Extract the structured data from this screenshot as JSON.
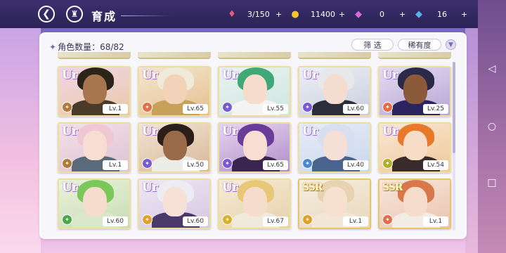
{
  "header": {
    "back_icon": "arrow-left-icon",
    "home_icon": "castle-icon",
    "title": "育成"
  },
  "resources": [
    {
      "name": "candy",
      "icon": "candy-icon",
      "value": "3/150",
      "color": "#e85a7a"
    },
    {
      "name": "coin",
      "icon": "coin-icon",
      "value": "11400",
      "color": "#f2c230"
    },
    {
      "name": "gem-pink",
      "icon": "gem-icon",
      "value": "0",
      "color": "#d86ad8"
    },
    {
      "name": "gem-blue",
      "icon": "diamond-icon",
      "value": "16",
      "color": "#5ab0f0"
    }
  ],
  "panel": {
    "count_label": "角色数量：68/82",
    "filter_label": "筛 选",
    "sort_label": "稀有度"
  },
  "cards": [
    {
      "rarity": "UR",
      "level": "Lv.1",
      "attr_color": "#b07a3a",
      "bg": [
        "#f3d6e6",
        "#e8c9a8"
      ],
      "hair": "#2b2418",
      "skin": "#a8764e",
      "body": "#4a3a2a"
    },
    {
      "rarity": "UR",
      "level": "Lv.65",
      "attr_color": "#e0704a",
      "bg": [
        "#f5e6d2",
        "#e3c08c"
      ],
      "hair": "#f0ead8",
      "skin": "#f2d2b8",
      "body": "#c7a05a"
    },
    {
      "rarity": "UR",
      "level": "Lv.55",
      "attr_color": "#7a5ad0",
      "bg": [
        "#e9f2f0",
        "#cfe7e0"
      ],
      "hair": "#3fa876",
      "skin": "#f6dccb",
      "body": "#f4f4f4"
    },
    {
      "rarity": "UR",
      "level": "Lv.60",
      "attr_color": "#7a5ad0",
      "bg": [
        "#eef0f6",
        "#c9cede"
      ],
      "hair": "#e8e8ea",
      "skin": "#f5dcd0",
      "body": "#2c2c3a"
    },
    {
      "rarity": "UR",
      "level": "Lv.25",
      "attr_color": "#e0704a",
      "bg": [
        "#e4dcf0",
        "#b7a5d6"
      ],
      "hair": "#2a2a48",
      "skin": "#8a5a3a",
      "body": "#2b2460"
    },
    {
      "rarity": "UR",
      "level": "Lv.1",
      "attr_color": "#b07a3a",
      "bg": [
        "#f4e2e8",
        "#dcc2d2"
      ],
      "hair": "#f0c8d4",
      "skin": "#f7ddd2",
      "body": "#5a6a7a"
    },
    {
      "rarity": "UR",
      "level": "Lv.50",
      "attr_color": "#7a5ad0",
      "bg": [
        "#f2e4d4",
        "#d8b898"
      ],
      "hair": "#2a1e18",
      "skin": "#9a6a48",
      "body": "#ecece8"
    },
    {
      "rarity": "UR",
      "level": "Lv.65",
      "attr_color": "#7a5ad0",
      "bg": [
        "#e6d6ee",
        "#b08cc8"
      ],
      "hair": "#6a3c9a",
      "skin": "#f7ddd2",
      "body": "#3a2450"
    },
    {
      "rarity": "UR",
      "level": "Lv.40",
      "attr_color": "#4a8ad0",
      "bg": [
        "#e8eef8",
        "#c8d6ec"
      ],
      "hair": "#d8e0f0",
      "skin": "#f5e0d8",
      "body": "#4a6490"
    },
    {
      "rarity": "UR",
      "level": "Lv.54",
      "attr_color": "#b0b030",
      "bg": [
        "#f8e8d6",
        "#f0c898"
      ],
      "hair": "#e8782a",
      "skin": "#f7dcc8",
      "body": "#3a2a2a"
    },
    {
      "rarity": "UR",
      "level": "Lv.60",
      "attr_color": "#4aa848",
      "bg": [
        "#eaf2dc",
        "#c8dcb4"
      ],
      "hair": "#7ac85a",
      "skin": "#f5dccc",
      "body": "#d8e8c8"
    },
    {
      "rarity": "UR",
      "level": "Lv.60",
      "attr_color": "#e0a02a",
      "bg": [
        "#f0e8f4",
        "#d4c6e2"
      ],
      "hair": "#ececf2",
      "skin": "#f7e0d6",
      "body": "#4a3a6a"
    },
    {
      "rarity": "UR",
      "level": "Lv.67",
      "attr_color": "#d8b030",
      "bg": [
        "#f6ecd8",
        "#e6d0a8"
      ],
      "hair": "#e8c878",
      "skin": "#f6dccb",
      "body": "#f0eadc"
    },
    {
      "rarity": "SSR",
      "level": "Lv.1",
      "attr_color": "#e0a02a",
      "bg": [
        "#f6eee0",
        "#e8d8bc"
      ],
      "hair": "#e8d2b0",
      "skin": "#f7e0d0",
      "body": "#f2e6d6"
    },
    {
      "rarity": "SSR",
      "level": "Lv.1",
      "attr_color": "#e0704a",
      "bg": [
        "#f8e6dc",
        "#eac4ae"
      ],
      "hair": "#d8784a",
      "skin": "#f6dccb",
      "body": "#f2ece4"
    }
  ],
  "nav": [
    {
      "icon": "nav-back-icon"
    },
    {
      "icon": "nav-home-icon"
    },
    {
      "icon": "nav-recent-icon"
    }
  ]
}
